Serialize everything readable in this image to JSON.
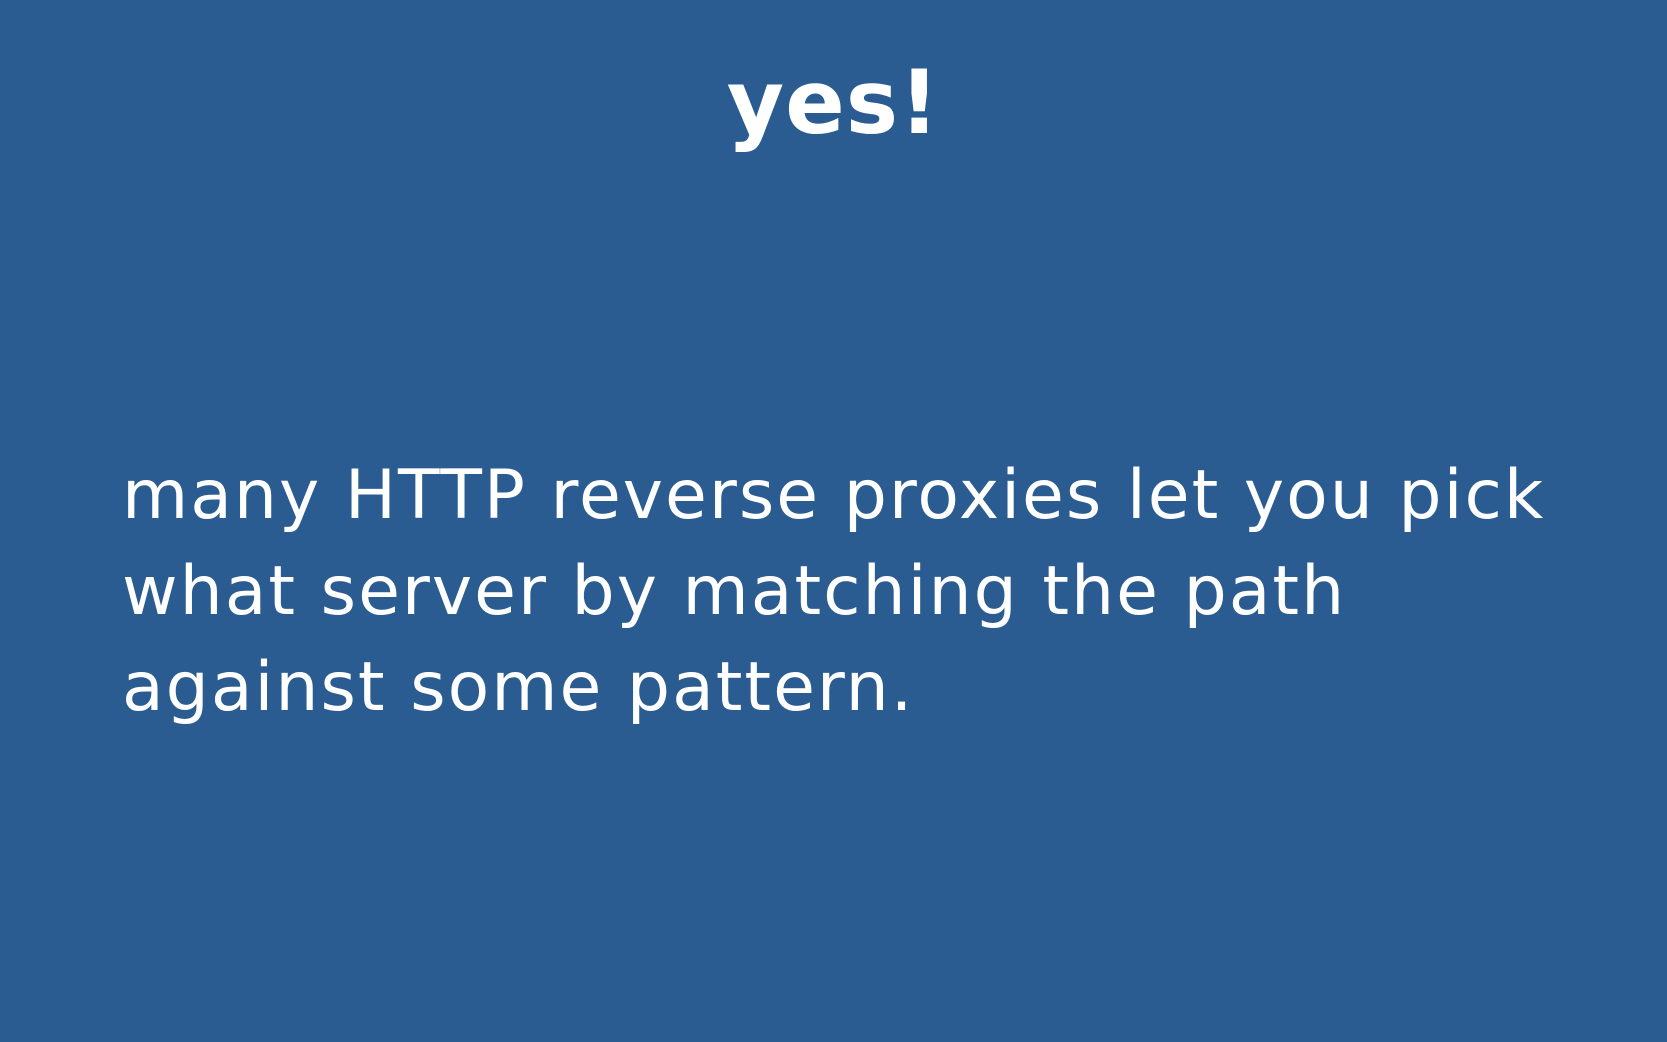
{
  "slide": {
    "title": "yes!",
    "body": "many HTTP reverse proxies let you pick what server by matching the path against some pattern.",
    "background_color": "#2a5c92",
    "text_color": "#ffffff"
  }
}
